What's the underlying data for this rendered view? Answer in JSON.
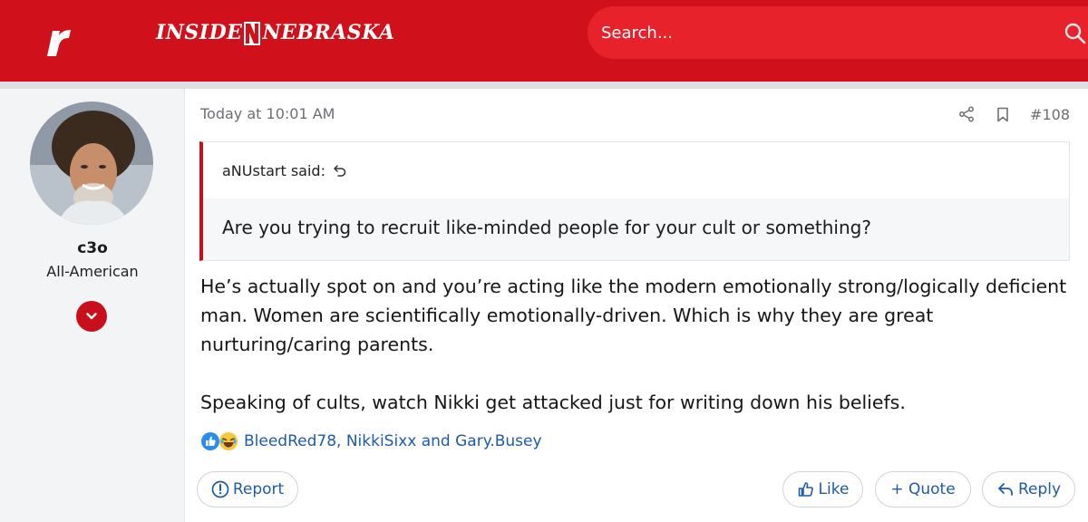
{
  "header": {
    "site_name_left": "INSIDE",
    "site_name_right": "NEBRASKA",
    "brand_color": "#d0101a",
    "search": {
      "placeholder": "Search...",
      "icon": "search-icon"
    }
  },
  "user": {
    "name": "c3o",
    "title": "All-American",
    "expand_icon": "chevron-down-icon"
  },
  "post": {
    "time": "Today at 10:01 AM",
    "number": "#108",
    "quote": {
      "author_line": "aNUstart said:",
      "text": "Are you trying to recruit like-minded people for your cult or something?"
    },
    "message": {
      "paragraph1": "He’s actually spot on and you’re acting like the modern emotionally strong/logically deficient man. Women are scientifically emotionally-driven. Which is why they are great nurturing/caring parents.",
      "paragraph2": "Speaking of cults, watch Nikki get attacked just for writing down his beliefs."
    },
    "reactions": {
      "icons": [
        "like-icon",
        "laugh-icon"
      ],
      "users_text": "BleedRed78, NikkiSixx and Gary.Busey"
    },
    "actions": {
      "report_label": "Report",
      "like_label": "Like",
      "quote_label": "+ Quote",
      "reply_label": "Reply"
    }
  }
}
